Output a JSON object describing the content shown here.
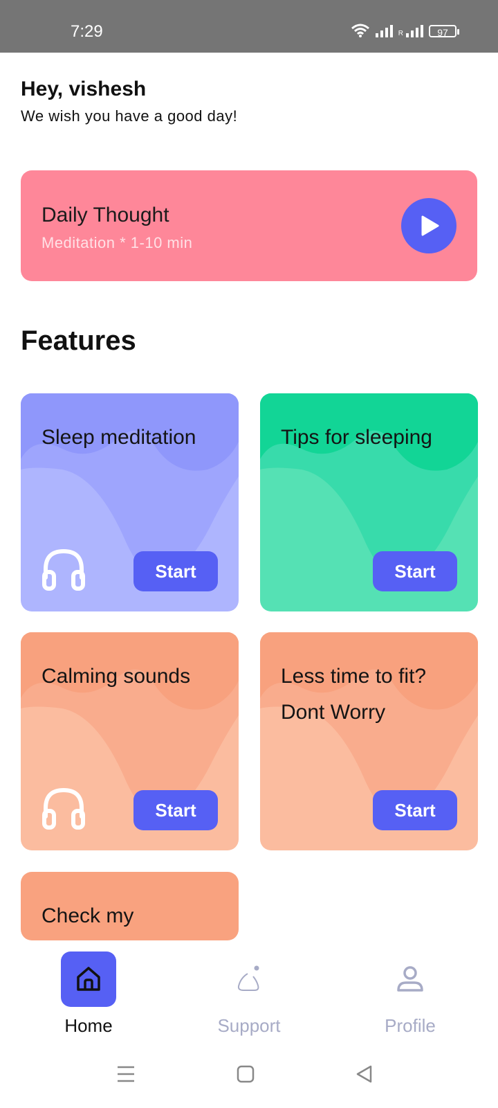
{
  "status_bar": {
    "time": "7:29",
    "roaming_label": "R",
    "battery": "97"
  },
  "greeting": {
    "title": "Hey, vishesh",
    "subtitle": "We wish you have a good day!"
  },
  "daily_thought": {
    "title": "Daily Thought",
    "subtitle": "Meditation * 1-10 min"
  },
  "features": {
    "heading": "Features",
    "cards": [
      {
        "title": "Sleep meditation",
        "button": "Start",
        "icon": "headphones-icon"
      },
      {
        "title": "Tips for sleeping",
        "button": "Start"
      },
      {
        "title": "Calming sounds",
        "button": "Start",
        "icon": "headphones-icon"
      },
      {
        "title": "Less time to fit? Dont Worry",
        "button": "Start"
      },
      {
        "title": "Check my Heal..."
      }
    ]
  },
  "bottom_nav": {
    "items": [
      {
        "label": "Home",
        "icon": "home-icon",
        "active": true
      },
      {
        "label": "Support",
        "icon": "support-icon",
        "active": false
      },
      {
        "label": "Profile",
        "icon": "profile-icon",
        "active": false
      }
    ]
  },
  "colors": {
    "accent": "#5660f4",
    "daily_card": "#fe8799",
    "card_purple": "#aeb5fe",
    "card_green": "#55e1b4",
    "card_orange": "#fbbc9f",
    "status_bar": "#757575"
  }
}
